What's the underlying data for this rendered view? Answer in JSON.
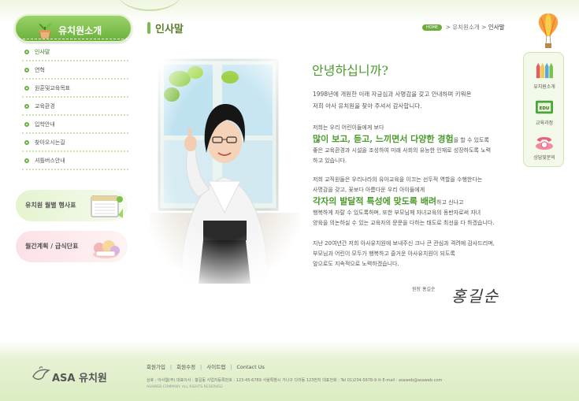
{
  "sidebar": {
    "title": "유치원소개",
    "menu": [
      {
        "label": "인사말",
        "active": true
      },
      {
        "label": "연혁"
      },
      {
        "label": "원훈및교육목표"
      },
      {
        "label": "교육환경"
      },
      {
        "label": "입학안내"
      },
      {
        "label": "찾아오시는길"
      },
      {
        "label": "셔틀버스안내"
      }
    ],
    "promo_monthly": "유치원 월별 행사표",
    "promo_meal": "월간계획 / 급식단표"
  },
  "header": {
    "title": "인사말",
    "breadcrumb_home": "HOME",
    "breadcrumb_parent": "유치원소개",
    "breadcrumb_current": "인사말",
    "breadcrumb_sep": ">"
  },
  "quick_menu": {
    "item1": "유치원소개",
    "item2": "교육과정",
    "item3": "상담및문의",
    "badge": "EDU"
  },
  "content": {
    "greeting": "안녕하십니까?",
    "p1_line1": "1998년에 개원한 이래 자긍심과 사명감을 갖고 안내하며 키워온",
    "p1_line2": "저희 아사 유치원을 찾아 주셔서 감사합니다.",
    "p2_line1": "저희는 우리 어린이들에게 보다",
    "p2_highlight": "많이 보고, 듣고, 느끼면서 다양한 경험",
    "p2_after": "을 할 수 있도록",
    "p2_line3": "좋은 교육환경과 시설을 조성하여 미래 사회의 유능한 인재로 성장하도록 노력",
    "p2_line4": "하고 있습니다.",
    "p3_line1": "저희 교직원들은 우리나라의 유아교육을 이끄는 선두적 역할을 수행한다는",
    "p3_line2": "사명감을 갖고, 꽃보다 아름다운 우리 아이들에게",
    "p3_highlight": "각자의 발달적 특성에 맞도록 배려",
    "p3_after": "하고 신나고",
    "p3_line4": "행복하게 자랄 수 있도록하며, 또한 부모님께 자녀교육의 동반자로써 자녀",
    "p3_line5": "양육을 의논하실 수 있는 교육자의 문문을 다하는 태도로 최선을 다 하겠습니다.",
    "p4_line1": "지난 20여년간 저희 아사유치원에 보내주신 크나 큰 관심과 격려에 감사드리며,",
    "p4_line2": "부모님과 어린이 모두가 행복하고 즐거운 아사유치원이 되도록",
    "p4_line3": "앞으로도 지속적으로 노력하겠습니다.",
    "sign_label": "원장  홍길순",
    "signature": "홍길순"
  },
  "footer": {
    "logo_text": "ASA 유치원",
    "links": [
      "회원가입",
      "회원수정",
      "사이트맵",
      "Contact Us"
    ],
    "link_sep": "|",
    "info": "상호 : 아사웹(주)  대표이사 : 홍길동   사업자등록번호 : 123-45-6789   서울특별시 가나구 다라동 123번지  대표전화 : Tel 01)234-5678-9   ✉  E-mail : asaweb@asaweb.com",
    "copyright": "ASAWEB COMPANY. ALL RIGHTS RESERVED"
  },
  "colors": {
    "accent_green": "#6cb23f",
    "highlight_green": "#4a9a2a"
  }
}
